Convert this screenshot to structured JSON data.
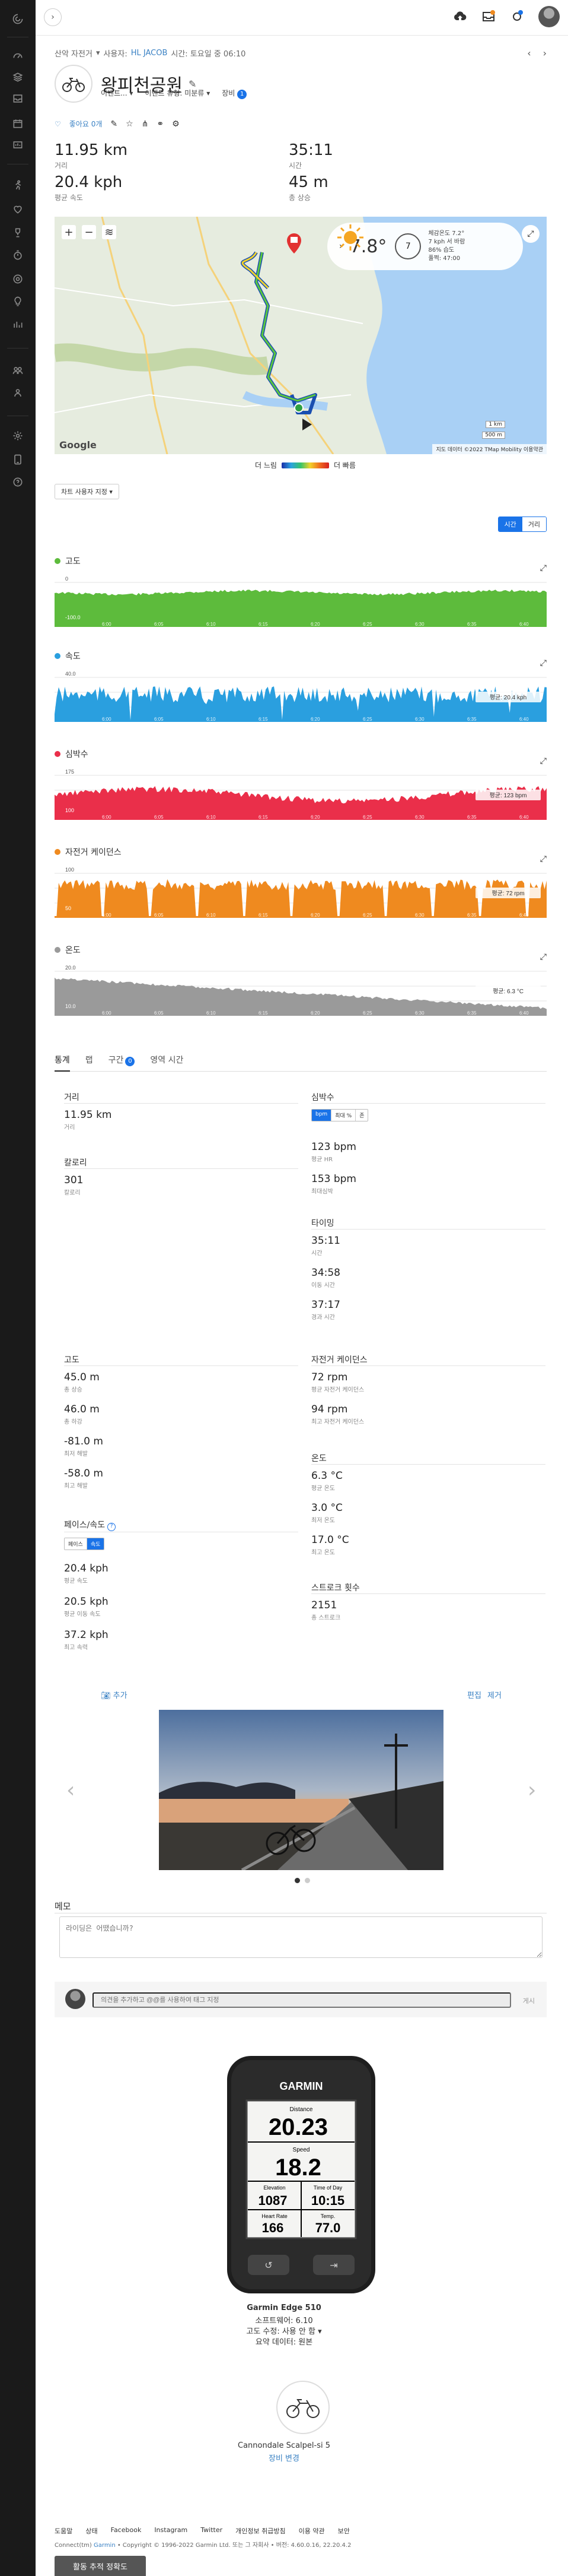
{
  "header": {
    "activity_type": "산악 자전거",
    "by_user_prefix": "사용자:",
    "user": "HL JACOB",
    "time_text": "시간: 토요일 중 06:10",
    "title": "왕피천공원",
    "dropdowns": [
      "이벤트...",
      "이벤트 유형: 미분류",
      "장비"
    ],
    "gear_count": "1"
  },
  "actions": {
    "like_label": "좋아요 0개"
  },
  "stats": [
    {
      "value": "11.95 km",
      "label": "거리"
    },
    {
      "value": "35:11",
      "label": "시간"
    },
    {
      "value": "20.4 kph",
      "label": "평균 속도"
    },
    {
      "value": "45 m",
      "label": "총 상승"
    }
  ],
  "map": {
    "temperature": "7.8°",
    "wind_speed": "7",
    "weather_details": [
      "체감온도 7.2°",
      "7 kph 서 바람",
      "86% 습도",
      "풀쩍: 47:00"
    ],
    "footer": "지도 데이터 ©2022 TMap Mobility   이용약관",
    "scale_label": "500 m",
    "scale_label2": "1 km"
  },
  "legend": {
    "slow": "더 느림",
    "fast": "더 빠름"
  },
  "custom_button": "차트 사용자 지정",
  "time_toggle": [
    "시간",
    "거리"
  ],
  "charts": [
    {
      "title": "고도",
      "color": "#5dbb3c",
      "ymax": "0",
      "ymin": "-100.0",
      "badge": ""
    },
    {
      "title": "속도",
      "color": "#2a9fdf",
      "ymax": "40.0",
      "ymin": "",
      "badge": "평균: 20.4 kph"
    },
    {
      "title": "심박수",
      "color": "#ea2f4a",
      "ymax": "175",
      "ymin": "100",
      "badge": "평균: 123 bpm"
    },
    {
      "title": "자전거 케이던스",
      "color": "#ef8a1f",
      "ymax": "100",
      "ymin": "50",
      "badge": "평균: 72 rpm"
    },
    {
      "title": "온도",
      "color": "#9a9a9a",
      "ymax": "20.0",
      "ymin": "10.0",
      "badge": "평균: 6.3 °C"
    }
  ],
  "x_ticks": [
    "6:00",
    "6:05",
    "6:10",
    "6:15",
    "6:20",
    "6:25",
    "6:30",
    "6:35",
    "6:40"
  ],
  "tabs": [
    "통계",
    "랩",
    "구간",
    "영역 시간"
  ],
  "tab_badge": "0",
  "summary": {
    "distance_title": "거리",
    "distance_value": "11.95 km",
    "distance_label": "거리",
    "calories_title": "칼로리",
    "calories_value": "301",
    "calories_label": "칼로리",
    "hr_title": "심박수",
    "hr_toggle": [
      "bpm",
      "최대 %",
      "존"
    ],
    "hr_avg": "123 bpm",
    "hr_avg_label": "평균 HR",
    "hr_max": "153 bpm",
    "hr_max_label": "최대심박",
    "timing_title": "타이밍",
    "time": "35:11",
    "time_label": "시간",
    "moving_time": "34:58",
    "moving_label": "이동 시간",
    "elapsed": "37:17",
    "elapsed_label": "경과 시간",
    "elev_title": "고도",
    "gain": "45.0 m",
    "gain_label": "총 상승",
    "loss": "46.0 m",
    "loss_label": "총 하강",
    "min_elev": "-81.0 m",
    "min_elev_label": "최저 해발",
    "max_elev": "-58.0 m",
    "max_elev_label": "최고 해발",
    "cad_title": "자전거 케이던스",
    "cad_avg": "72 rpm",
    "cad_avg_label": "평균 자전거 케이던스",
    "cad_max": "94 rpm",
    "cad_max_label": "최고 자전거 케이던스",
    "temp_title": "온도",
    "temp_avg": "6.3 °C",
    "temp_avg_label": "평균 온도",
    "temp_min": "3.0 °C",
    "temp_min_label": "최저 온도",
    "temp_max": "17.0 °C",
    "temp_max_label": "최고 온도",
    "pace_title": "페이스/속도",
    "pace_toggle": [
      "페이스",
      "속도"
    ],
    "speed_avg": "20.4 kph",
    "speed_avg_label": "평균 속도",
    "speed_moving": "20.5 kph",
    "speed_moving_label": "평균 이동 속도",
    "speed_max": "37.2 kph",
    "speed_max_label": "최고 속력",
    "strokes_title": "스트로크 횟수",
    "strokes": "2151",
    "strokes_label": "총 스트로크"
  },
  "photo": {
    "add": "추가",
    "edit": "편집",
    "delete": "제거"
  },
  "notes": {
    "title": "메모",
    "placeholder": "라이딩은 어땠습니까?",
    "comment_placeholder": "의견을 추가하고 @@를 사용하여 태그 지정",
    "post": "게시"
  },
  "device": {
    "brand": "GARMIN",
    "screen": {
      "distance_label": "Distance",
      "distance": "20.23",
      "speed_label": "Speed",
      "speed": "18.2",
      "elev_label": "Elevation",
      "elev": "1087",
      "tod_label": "Time of Day",
      "tod": "10:15",
      "hr_label": "Heart Rate",
      "hr": "166",
      "temp_label": "Temp.",
      "temp": "77.0"
    },
    "name": "Garmin Edge 510",
    "software": "소프트웨어: 6.10",
    "elevation_correction": "고도 수정: 사용 안 함",
    "summary_data": "요약 데이터: 원본"
  },
  "gear": {
    "name": "Cannondale Scalpel-si 5",
    "change": "장비 변경"
  },
  "footer": {
    "links": [
      "도움말",
      "상태",
      "Facebook",
      "Instagram",
      "Twitter",
      "개인정보 취급방침",
      "이용 약관",
      "보안"
    ],
    "copyright_prefix": "Connect(tm)",
    "brand": "Garmin",
    "copyright_suffix": "• Copyright © 1996-2022 Garmin Ltd. 또는 그 자회사 • 버전: 4.60.0.16, 22.20.4.2",
    "button": "활동 추적 정확도"
  },
  "colors": {
    "accent": "#1a73e8",
    "rail": "#1a1a1a",
    "link": "#3b82c4"
  }
}
